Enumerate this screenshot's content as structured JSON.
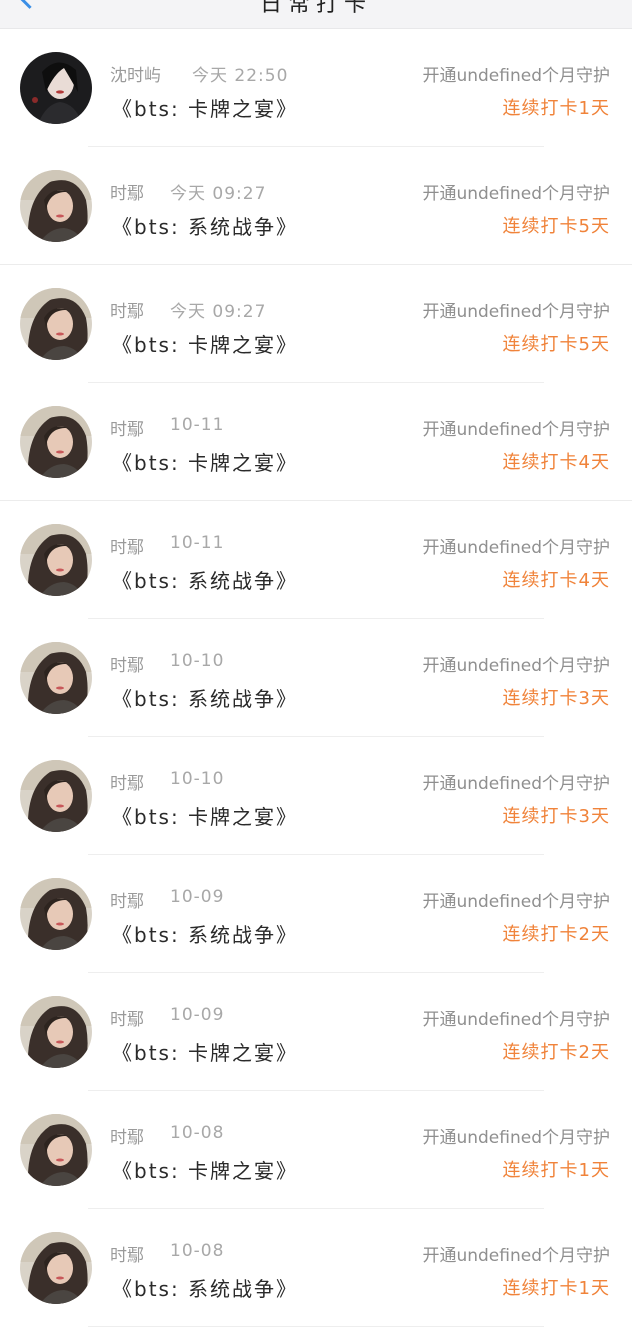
{
  "header": {
    "title": "日常打卡"
  },
  "rows": [
    {
      "name": "沈时屿",
      "time": "今天 22:50",
      "guard": "开通undefined个月守护",
      "work": "《bts: 卡牌之宴》",
      "streak": "连续打卡1天",
      "avatar": "dark"
    },
    {
      "name": "时鄢",
      "time": "今天 09:27",
      "guard": "开通undefined个月守护",
      "work": "《bts: 系统战争》",
      "streak": "连续打卡5天",
      "avatar": "girl"
    },
    {
      "name": "时鄢",
      "time": "今天 09:27",
      "guard": "开通undefined个月守护",
      "work": "《bts: 卡牌之宴》",
      "streak": "连续打卡5天",
      "avatar": "girl"
    },
    {
      "name": "时鄢",
      "time": "10-11",
      "guard": "开通undefined个月守护",
      "work": "《bts: 卡牌之宴》",
      "streak": "连续打卡4天",
      "avatar": "girl"
    },
    {
      "name": "时鄢",
      "time": "10-11",
      "guard": "开通undefined个月守护",
      "work": "《bts: 系统战争》",
      "streak": "连续打卡4天",
      "avatar": "girl"
    },
    {
      "name": "时鄢",
      "time": "10-10",
      "guard": "开通undefined个月守护",
      "work": "《bts: 系统战争》",
      "streak": "连续打卡3天",
      "avatar": "girl"
    },
    {
      "name": "时鄢",
      "time": "10-10",
      "guard": "开通undefined个月守护",
      "work": "《bts: 卡牌之宴》",
      "streak": "连续打卡3天",
      "avatar": "girl"
    },
    {
      "name": "时鄢",
      "time": "10-09",
      "guard": "开通undefined个月守护",
      "work": "《bts: 系统战争》",
      "streak": "连续打卡2天",
      "avatar": "girl"
    },
    {
      "name": "时鄢",
      "time": "10-09",
      "guard": "开通undefined个月守护",
      "work": "《bts: 卡牌之宴》",
      "streak": "连续打卡2天",
      "avatar": "girl"
    },
    {
      "name": "时鄢",
      "time": "10-08",
      "guard": "开通undefined个月守护",
      "work": "《bts: 卡牌之宴》",
      "streak": "连续打卡1天",
      "avatar": "girl"
    },
    {
      "name": "时鄢",
      "time": "10-08",
      "guard": "开通undefined个月守护",
      "work": "《bts: 系统战争》",
      "streak": "连续打卡1天",
      "avatar": "girl"
    }
  ]
}
